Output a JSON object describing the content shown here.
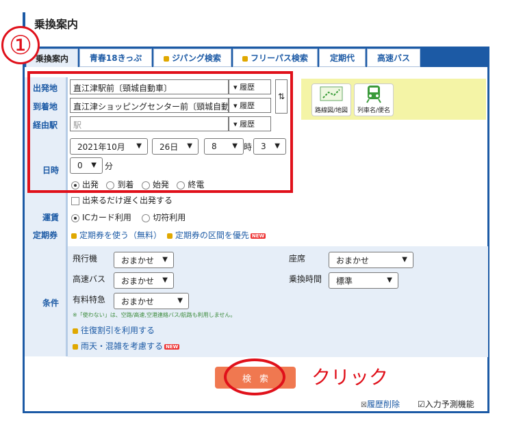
{
  "page": {
    "title": "乗換案内"
  },
  "annotation": {
    "step_number": "①",
    "click_label": "クリック"
  },
  "tabs": [
    {
      "label": "乗換案内",
      "active": true,
      "locked": false
    },
    {
      "label": "青春18きっぷ",
      "active": false,
      "locked": false
    },
    {
      "label": "ジパング検索",
      "active": false,
      "locked": true
    },
    {
      "label": "フリーパス検索",
      "active": false,
      "locked": true
    },
    {
      "label": "定期代",
      "active": false,
      "locked": false
    },
    {
      "label": "高速バス",
      "active": false,
      "locked": false
    }
  ],
  "form": {
    "departure": {
      "label": "出発地",
      "value": "直江津駅前〔頸城自動車〕",
      "history": "履歴"
    },
    "arrival": {
      "label": "到着地",
      "value": "直江津ショッピングセンター前〔頸城自動車",
      "history": "履歴"
    },
    "via": {
      "label": "経由駅",
      "placeholder": "駅",
      "history": "履歴"
    },
    "datetime": {
      "label": "日時",
      "year_month": "2021年10月",
      "day": "26日",
      "hour": "8",
      "hour_unit": "時",
      "minute_tens": "3",
      "minute_ones": "0",
      "minute_unit": "分",
      "modes": [
        "出発",
        "到着",
        "始発",
        "終電"
      ],
      "selected_mode": "出発",
      "late_departure": "出来るだけ遅く出発する"
    },
    "fare": {
      "label": "運賃",
      "options": [
        "ICカード利用",
        "切符利用"
      ],
      "selected": "ICカード利用"
    },
    "commuter": {
      "label": "定期券",
      "use": "定期券を使う（無料）",
      "priority": "定期券の区間を優先",
      "new": "NEW"
    },
    "conditions": {
      "label": "条件",
      "airplane": {
        "label": "飛行機",
        "value": "おまかせ"
      },
      "highway_bus": {
        "label": "高速バス",
        "value": "おまかせ"
      },
      "limited_express": {
        "label": "有料特急",
        "value": "おまかせ"
      },
      "seat": {
        "label": "座席",
        "value": "おまかせ"
      },
      "transfer_time": {
        "label": "乗換時間",
        "value": "標準"
      },
      "note": "※「使わない」は、空路/高速,空港連絡バス/航路も利用しません。",
      "round_trip": "往復割引を利用する",
      "weather": "雨天・混雑を考慮する",
      "new": "NEW"
    }
  },
  "side_buttons": {
    "map": "路線図/地図",
    "train": "列車名/便名"
  },
  "search_button": "検索",
  "footer": {
    "delete_history": "履歴削除",
    "predictive_input": "入力予測機能"
  },
  "colors": {
    "primary": "#1c5aa5",
    "accent": "#f07850",
    "annotation": "#e0101a"
  }
}
